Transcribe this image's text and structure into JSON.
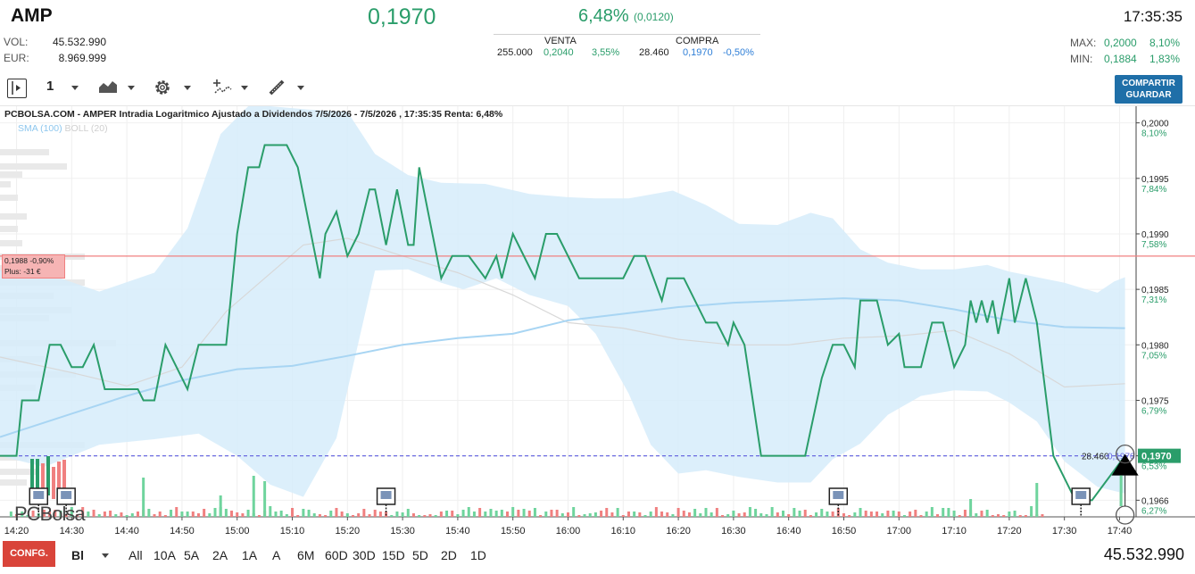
{
  "header": {
    "ticker": "AMP",
    "price": "0,1970",
    "change_pct": "6,48%",
    "change_abs": "(0,0120)",
    "time": "17:35:35",
    "vol_label": "VOL:",
    "vol_value": "45.532.990",
    "eur_label": "EUR:",
    "eur_value": "8.969.999",
    "venta_label": "VENTA",
    "venta_qty": "255.000",
    "venta_price": "0,2040",
    "venta_pct": "3,55%",
    "compra_label": "COMPRA",
    "compra_qty": "28.460",
    "compra_price": "0,1970",
    "compra_pct": "-0,50%",
    "max_label": "MAX:",
    "max_value": "0,2000",
    "max_pct": "8,10%",
    "min_label": "MIN:",
    "min_value": "0,1884",
    "min_pct": "1,83%"
  },
  "toolbar": {
    "interval": "1",
    "share_line1": "COMPARTIR",
    "share_line2": "GUARDAR"
  },
  "chart_title": "PCBOLSA.COM - AMPER Intradia Logaritmico Ajustado a Dividendos 7/5/2026 - 7/5/2026 , 17:35:35 Renta: 6,48%",
  "legend": {
    "sma": "SMA (100)",
    "boll": "BOLL (20)"
  },
  "watermark": "PCBolsa",
  "ref_line": {
    "label1": "0,1988  -0,90%",
    "label2": "Plus: -31 €",
    "color": "#f08080"
  },
  "last_line": {
    "qty": "28.460",
    "price": "0,1970",
    "color": "#6a6ae0"
  },
  "colors": {
    "price_line": "#2a9d6a",
    "band": "#d6ecfa",
    "sma": "#a8d5f3",
    "boll_mid": "#d8d8d8",
    "vol_up": "#6fd49d",
    "vol_down": "#f08080",
    "accent": "#1f6fa8"
  },
  "bottom": {
    "confg": "CONFG.",
    "mode": "Bl",
    "periods": [
      "All",
      "10A",
      "5A",
      "2A",
      "1A",
      "A",
      "6M",
      "60D",
      "30D",
      "15D",
      "5D",
      "2D",
      "1D"
    ],
    "volume": "45.532.990"
  },
  "chart_data": {
    "type": "line",
    "title": "PCBOLSA.COM - AMPER Intradia Logaritmico Ajustado a Dividendos 7/5/2026 - 7/5/2026 , 17:35:35 Renta: 6,48%",
    "x_ticks": [
      "14:20",
      "14:30",
      "14:40",
      "14:50",
      "15:00",
      "15:10",
      "15:20",
      "15:30",
      "15:40",
      "15:50",
      "16:00",
      "16:10",
      "16:20",
      "16:30",
      "16:40",
      "16:50",
      "17:00",
      "17:10",
      "17:20",
      "17:30",
      "17:40"
    ],
    "y_ticks": [
      {
        "value": "0,2000",
        "pct": "8,10%"
      },
      {
        "value": "0,1995",
        "pct": "7,84%"
      },
      {
        "value": "0,1990",
        "pct": "7,58%"
      },
      {
        "value": "0,1985",
        "pct": "7,31%"
      },
      {
        "value": "0,1980",
        "pct": "7,05%"
      },
      {
        "value": "0,1975",
        "pct": "6,79%"
      },
      {
        "value": "0,1970",
        "pct": "6,53%"
      },
      {
        "value": "0,1966",
        "pct": "6,27%"
      }
    ],
    "ylim": [
      0.19645,
      0.20015
    ],
    "xlim_minutes": [
      857,
      1063
    ],
    "series": [
      {
        "name": "Precio",
        "points": [
          [
            857,
            0.197
          ],
          [
            860,
            0.197
          ],
          [
            861,
            0.1975
          ],
          [
            864,
            0.1975
          ],
          [
            866,
            0.198
          ],
          [
            868,
            0.198
          ],
          [
            870,
            0.1978
          ],
          [
            872,
            0.1978
          ],
          [
            874,
            0.198
          ],
          [
            876,
            0.1976
          ],
          [
            882,
            0.1976
          ],
          [
            883,
            0.1975
          ],
          [
            885,
            0.1975
          ],
          [
            887,
            0.198
          ],
          [
            891,
            0.1976
          ],
          [
            893,
            0.198
          ],
          [
            898,
            0.198
          ],
          [
            900,
            0.199
          ],
          [
            902,
            0.1996
          ],
          [
            904,
            0.1996
          ],
          [
            905,
            0.1998
          ],
          [
            909,
            0.1998
          ],
          [
            911,
            0.1996
          ],
          [
            915,
            0.1986
          ],
          [
            916,
            0.199
          ],
          [
            918,
            0.1992
          ],
          [
            920,
            0.1988
          ],
          [
            922,
            0.199
          ],
          [
            924,
            0.1994
          ],
          [
            925,
            0.1994
          ],
          [
            927,
            0.1989
          ],
          [
            929,
            0.1994
          ],
          [
            931,
            0.1989
          ],
          [
            932,
            0.1989
          ],
          [
            933,
            0.1996
          ],
          [
            937,
            0.1986
          ],
          [
            939,
            0.1988
          ],
          [
            942,
            0.1988
          ],
          [
            945,
            0.1986
          ],
          [
            947,
            0.1988
          ],
          [
            948,
            0.1986
          ],
          [
            950,
            0.199
          ],
          [
            954,
            0.1986
          ],
          [
            956,
            0.199
          ],
          [
            958,
            0.199
          ],
          [
            962,
            0.1986
          ],
          [
            970,
            0.1986
          ],
          [
            972,
            0.1988
          ],
          [
            974,
            0.1988
          ],
          [
            977,
            0.1984
          ],
          [
            978,
            0.1986
          ],
          [
            981,
            0.1986
          ],
          [
            985,
            0.1982
          ],
          [
            987,
            0.1982
          ],
          [
            989,
            0.198
          ],
          [
            990,
            0.1982
          ],
          [
            992,
            0.198
          ],
          [
            995,
            0.197
          ],
          [
            1003,
            0.197
          ],
          [
            1006,
            0.1977
          ],
          [
            1008,
            0.198
          ],
          [
            1010,
            0.198
          ],
          [
            1012,
            0.1978
          ],
          [
            1013,
            0.1984
          ],
          [
            1016,
            0.1984
          ],
          [
            1018,
            0.198
          ],
          [
            1020,
            0.1981
          ],
          [
            1021,
            0.1978
          ],
          [
            1024,
            0.1978
          ],
          [
            1026,
            0.1982
          ],
          [
            1028,
            0.1982
          ],
          [
            1030,
            0.1978
          ],
          [
            1032,
            0.198
          ],
          [
            1033,
            0.1984
          ],
          [
            1034,
            0.1982
          ],
          [
            1035,
            0.1984
          ],
          [
            1036,
            0.1982
          ],
          [
            1037,
            0.1984
          ],
          [
            1038,
            0.1981
          ],
          [
            1040,
            0.1986
          ],
          [
            1041,
            0.1982
          ],
          [
            1043,
            0.1986
          ],
          [
            1045,
            0.1982
          ]
        ]
      }
    ]
  }
}
